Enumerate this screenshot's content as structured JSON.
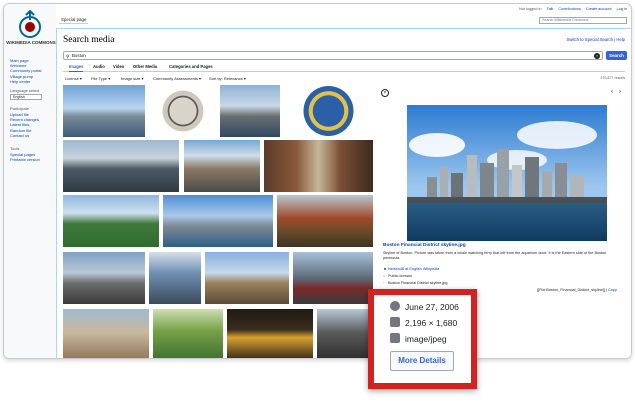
{
  "sidebar": {
    "logo_text": "WIKIMEDIA COMMONS",
    "nav": [
      "Main page",
      "Welcome",
      "Community portal",
      "Village pump",
      "Help center"
    ],
    "language_header": "Language select",
    "language_value": "English",
    "participate_header": "Participate",
    "participate": [
      "Upload file",
      "Recent changes",
      "Latest files",
      "Random file",
      "Contact us"
    ],
    "tools_header": "Tools",
    "tools": [
      "Special pages",
      "Printable version"
    ]
  },
  "topbar": {
    "special_tab": "Special page",
    "personal": [
      "Not logged in",
      "Talk",
      "Contributions",
      "Create account",
      "Log in"
    ],
    "search_placeholder": "Search Wikimedia Commons"
  },
  "page": {
    "title": "Search media",
    "switch_link": "Switch to Special:Search | Help",
    "query": "Boston",
    "search_button": "Search",
    "tabs": [
      "Images",
      "Audio",
      "Video",
      "Other Media",
      "Categories and Pages"
    ],
    "filters": [
      "License",
      "File Type",
      "Image size",
      "Community Assessments",
      "Sort by: Relevance"
    ],
    "result_count": "370,877 results"
  },
  "detail": {
    "file_title": "Boston Financial District skyline.jpg",
    "description": "Skyline of Boston. Picture was taken from a whale watching ferry that left from the aquarium dock. It is the Eastern side of the Boston peninsula.",
    "author": "Nelson48 at English Wikipedia",
    "license": "Public domain",
    "filename": "Boston Financial District skyline.jpg",
    "wikitext": "[[File:Boston_Financial_District_skyline]]",
    "copy_label": "Copy"
  },
  "callout": {
    "date": "June 27, 2006",
    "dimensions": "2,196 × 1,680",
    "mime": "image/jpeg",
    "more_details": "More Details"
  },
  "colors": {
    "accent": "#3366cc",
    "callout_border": "#d32222",
    "link": "#0645ad"
  },
  "icons": [
    "commons-logo-icon",
    "search-icon",
    "clear-icon",
    "close-icon",
    "prev-arrow-icon",
    "next-arrow-icon",
    "clock-icon",
    "camera-icon",
    "file-icon",
    "user-icon",
    "license-icon"
  ]
}
